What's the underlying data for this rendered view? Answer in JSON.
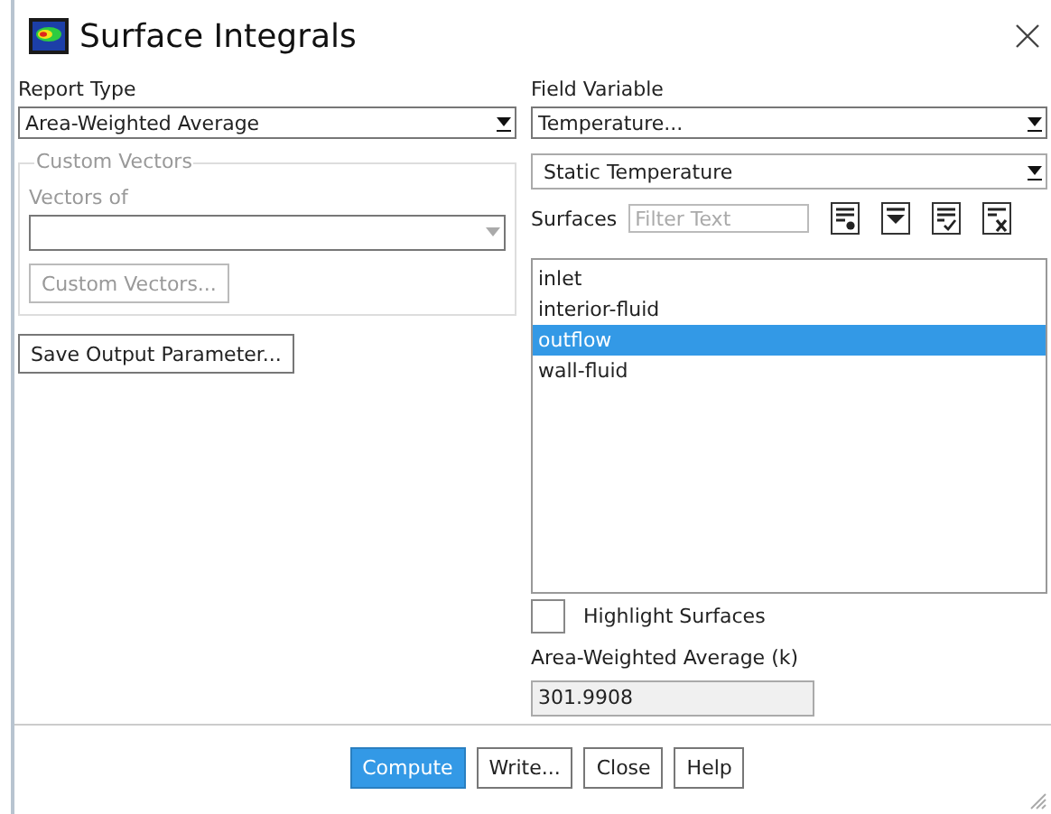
{
  "window": {
    "title": "Surface Integrals"
  },
  "report_type": {
    "label": "Report Type",
    "value": "Area-Weighted Average"
  },
  "custom_vectors": {
    "title": "Custom Vectors",
    "vectors_of_label": "Vectors of",
    "disabled": true,
    "button": "Custom Vectors..."
  },
  "save_button": "Save Output Parameter...",
  "field_variable": {
    "label": "Field Variable",
    "category": "Temperature...",
    "value": "Static Temperature"
  },
  "surfaces": {
    "label": "Surfaces",
    "placeholder": "Filter Text",
    "items": [
      {
        "label": "inlet",
        "selected": false
      },
      {
        "label": "interior-fluid",
        "selected": false
      },
      {
        "label": "outflow",
        "selected": true
      },
      {
        "label": "wall-fluid",
        "selected": false
      }
    ]
  },
  "highlight_surfaces": {
    "label": "Highlight Surfaces",
    "checked": false
  },
  "result": {
    "label": "Area-Weighted Average (k)",
    "value": "301.9908"
  },
  "buttons": [
    {
      "label": "Compute",
      "primary": true
    },
    {
      "label": "Write...",
      "primary": false
    },
    {
      "label": "Close",
      "primary": false
    },
    {
      "label": "Help",
      "primary": false
    }
  ]
}
